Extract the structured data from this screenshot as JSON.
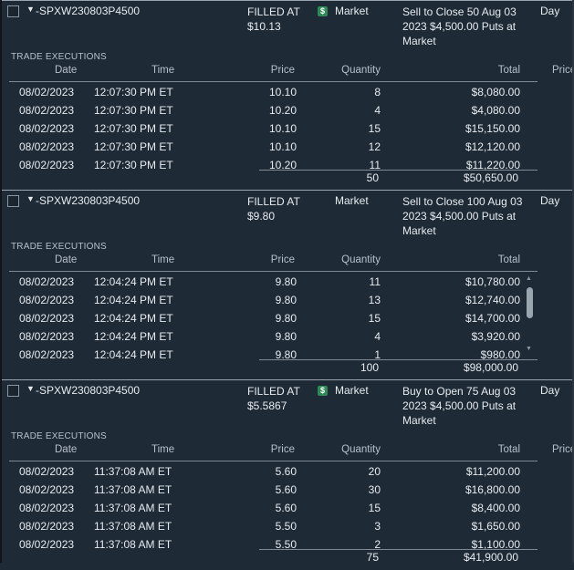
{
  "headers": {
    "date": "Date",
    "time": "Time",
    "price": "Price",
    "quantity": "Quantity",
    "total": "Total",
    "price_extra": "Price"
  },
  "exec_title": "TRADE EXECUTIONS",
  "orders": [
    {
      "symbol": "-SPXW230803P4500",
      "status_line1": "FILLED AT",
      "status_line2": "$10.13",
      "show_dollar_icon": true,
      "dollar_icon": "$",
      "order_type": "Market",
      "description": "Sell to Close 50 Aug 03 2023 $4,500.00 Puts at Market",
      "tif": "Day",
      "executions": [
        {
          "date": "08/02/2023",
          "time": "12:07:30 PM ET",
          "price": "10.10",
          "qty": "8",
          "total": "$8,080.00"
        },
        {
          "date": "08/02/2023",
          "time": "12:07:30 PM ET",
          "price": "10.20",
          "qty": "4",
          "total": "$4,080.00"
        },
        {
          "date": "08/02/2023",
          "time": "12:07:30 PM ET",
          "price": "10.10",
          "qty": "15",
          "total": "$15,150.00"
        },
        {
          "date": "08/02/2023",
          "time": "12:07:30 PM ET",
          "price": "10.10",
          "qty": "12",
          "total": "$12,120.00"
        },
        {
          "date": "08/02/2023",
          "time": "12:07:30 PM ET",
          "price": "10.20",
          "qty": "11",
          "total": "$11,220.00"
        }
      ],
      "total_qty": "50",
      "total_amount": "$50,650.00",
      "show_price_extra": true,
      "show_scrollbar": false
    },
    {
      "symbol": "-SPXW230803P4500",
      "status_line1": "FILLED AT",
      "status_line2": "$9.80",
      "show_dollar_icon": false,
      "dollar_icon": "$",
      "order_type": "Market",
      "description": "Sell to Close 100 Aug 03 2023 $4,500.00 Puts at Market",
      "tif": "Day",
      "executions": [
        {
          "date": "08/02/2023",
          "time": "12:04:24 PM ET",
          "price": "9.80",
          "qty": "11",
          "total": "$10,780.00"
        },
        {
          "date": "08/02/2023",
          "time": "12:04:24 PM ET",
          "price": "9.80",
          "qty": "13",
          "total": "$12,740.00"
        },
        {
          "date": "08/02/2023",
          "time": "12:04:24 PM ET",
          "price": "9.80",
          "qty": "15",
          "total": "$14,700.00"
        },
        {
          "date": "08/02/2023",
          "time": "12:04:24 PM ET",
          "price": "9.80",
          "qty": "4",
          "total": "$3,920.00"
        },
        {
          "date": "08/02/2023",
          "time": "12:04:24 PM ET",
          "price": "9.80",
          "qty": "1",
          "total": "$980.00"
        }
      ],
      "total_qty": "100",
      "total_amount": "$98,000.00",
      "show_price_extra": false,
      "show_scrollbar": true
    },
    {
      "symbol": "-SPXW230803P4500",
      "status_line1": "FILLED AT",
      "status_line2": "$5.5867",
      "show_dollar_icon": true,
      "dollar_icon": "$",
      "order_type": "Market",
      "description": "Buy to Open 75 Aug 03 2023 $4,500.00 Puts at Market",
      "tif": "Day",
      "executions": [
        {
          "date": "08/02/2023",
          "time": "11:37:08 AM ET",
          "price": "5.60",
          "qty": "20",
          "total": "$11,200.00"
        },
        {
          "date": "08/02/2023",
          "time": "11:37:08 AM ET",
          "price": "5.60",
          "qty": "30",
          "total": "$16,800.00"
        },
        {
          "date": "08/02/2023",
          "time": "11:37:08 AM ET",
          "price": "5.60",
          "qty": "15",
          "total": "$8,400.00"
        },
        {
          "date": "08/02/2023",
          "time": "11:37:08 AM ET",
          "price": "5.50",
          "qty": "3",
          "total": "$1,650.00"
        },
        {
          "date": "08/02/2023",
          "time": "11:37:08 AM ET",
          "price": "5.50",
          "qty": "2",
          "total": "$1,100.00"
        }
      ],
      "total_qty": "75",
      "total_amount": "$41,900.00",
      "show_price_extra": true,
      "show_scrollbar": false
    }
  ],
  "colors": {
    "background": "#1e2a36",
    "text": "#e6ebf0",
    "muted": "#b6c0ca",
    "divider": "#7f8a95",
    "dollar_icon": "#2e8b57"
  }
}
